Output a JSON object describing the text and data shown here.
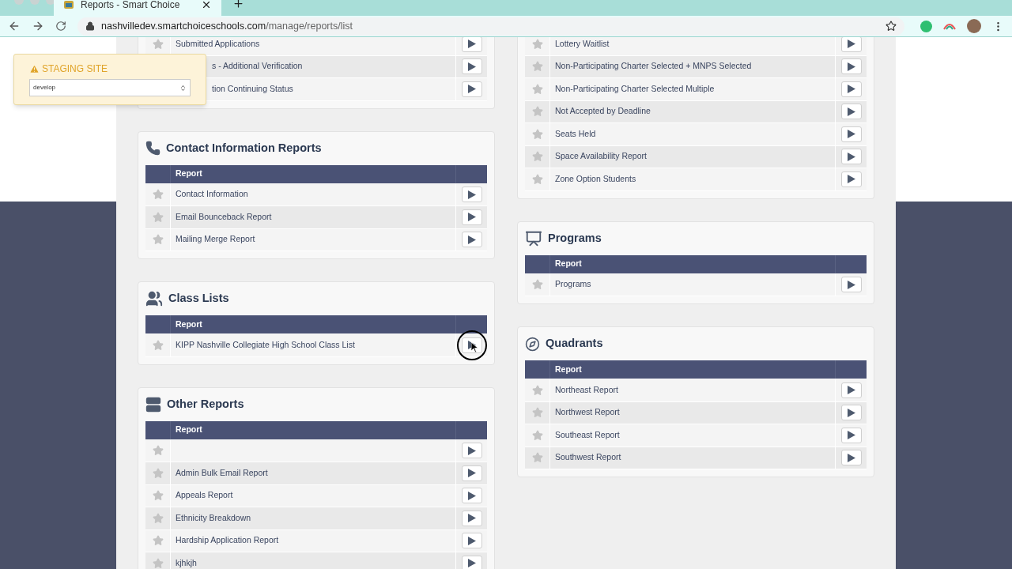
{
  "browser": {
    "tab_title": "Reports - Smart Choice",
    "url_host": "nashvilledev.smartchoiceschools.com",
    "url_path": "/manage/reports/list"
  },
  "staging": {
    "title": "STAGING SITE",
    "value": "develop"
  },
  "columns": [
    [
      {
        "kind": "continued",
        "rows": [
          {
            "name": "Submitted Applications"
          },
          {
            "name": "s - Additional Verification",
            "covered": true
          },
          {
            "name": "tion Continuing Status",
            "covered": true
          }
        ]
      },
      {
        "kind": "full",
        "title": "Contact Information Reports",
        "header": "Report",
        "rows": [
          {
            "name": "Contact Information"
          },
          {
            "name": "Email Bounceback Report"
          },
          {
            "name": "Mailing Merge Report"
          }
        ]
      },
      {
        "kind": "full",
        "title": "Class Lists",
        "header": "Report",
        "rows": [
          {
            "name": "KIPP Nashville Collegiate High School Class List",
            "pointer": true
          }
        ]
      },
      {
        "kind": "full",
        "title": "Other Reports",
        "header": "Report",
        "rows": [
          {},
          {
            "name": "Admin Bulk Email Report"
          },
          {
            "name": "Appeals Report"
          },
          {
            "name": "Ethnicity Breakdown"
          },
          {
            "name": "Hardship Application Report"
          },
          {
            "name": "kjhkjh"
          }
        ]
      }
    ],
    [
      {
        "kind": "continued",
        "rows": [
          {
            "name": "Lottery Waitlist"
          },
          {
            "name": "Non-Participating Charter Selected + MNPS Selected"
          },
          {
            "name": "Non-Participating Charter Selected Multiple"
          },
          {
            "name": "Not Accepted by Deadline"
          },
          {
            "name": "Seats Held"
          },
          {
            "name": "Space Availability Report"
          },
          {
            "name": "Zone Option Students"
          }
        ]
      },
      {
        "kind": "full",
        "title": "Programs",
        "header": "Report",
        "rows": [
          {
            "name": "Programs"
          }
        ]
      },
      {
        "kind": "full",
        "title": "Quadrants",
        "header": "Report",
        "rows": [
          {
            "name": "Northeast Report"
          },
          {
            "name": "Northwest Report"
          },
          {
            "name": "Southeast Report"
          },
          {
            "name": "Southwest Report"
          }
        ]
      }
    ]
  ]
}
